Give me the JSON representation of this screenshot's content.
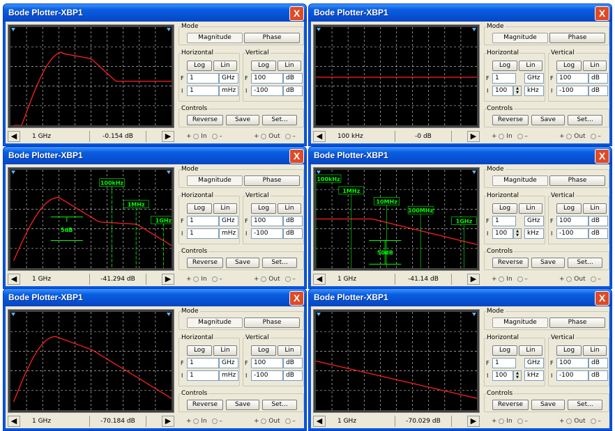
{
  "windows": [
    {
      "title": "Bode Plotter-XBP1",
      "readout_freq": "1 GHz",
      "readout_db": "-0.154 dB",
      "h_f_val": "1",
      "h_f_unit": "GHz",
      "h_i_val": "1",
      "h_i_unit": "mHz",
      "v_f_val": "100",
      "v_f_unit": "dB",
      "v_i_val": "-100",
      "v_i_unit": "dB",
      "curve": "a",
      "markers": []
    },
    {
      "title": "Bode Plotter-XBP1",
      "readout_freq": "100 kHz",
      "readout_db": "-0 dB",
      "h_f_val": "1",
      "h_f_unit": "GHz",
      "h_i_val": "100",
      "h_i_unit": "kHz",
      "v_f_val": "100",
      "v_f_unit": "dB",
      "v_i_val": "-100",
      "v_i_unit": "dB",
      "curve": "flat",
      "markers": []
    },
    {
      "title": "Bode Plotter-XBP1",
      "readout_freq": "1 GHz",
      "readout_db": "-41.294 dB",
      "h_f_val": "1",
      "h_f_unit": "GHz",
      "h_i_val": "1",
      "h_i_unit": "mHz",
      "v_f_val": "100",
      "v_f_unit": "dB",
      "v_i_val": "-100",
      "v_i_unit": "dB",
      "curve": "b",
      "markers": [
        "100kHz",
        "1MHz",
        "1GHz",
        "5dB"
      ]
    },
    {
      "title": "Bode Plotter-XBP1",
      "readout_freq": "1 GHz",
      "readout_db": "-41.14 dB",
      "h_f_val": "1",
      "h_f_unit": "GHz",
      "h_i_val": "100",
      "h_i_unit": "kHz",
      "v_f_val": "100",
      "v_f_unit": "dB",
      "v_i_val": "-100",
      "v_i_unit": "dB",
      "curve": "c",
      "markers": [
        "100kHz",
        "1MHz",
        "10MHz",
        "100MHz",
        "1GHz",
        "50dB"
      ]
    },
    {
      "title": "Bode Plotter-XBP1",
      "readout_freq": "1 GHz",
      "readout_db": "-70.184 dB",
      "h_f_val": "1",
      "h_f_unit": "GHz",
      "h_i_val": "1",
      "h_i_unit": "mHz",
      "v_f_val": "100",
      "v_f_unit": "dB",
      "v_i_val": "-100",
      "v_i_unit": "dB",
      "curve": "d",
      "markers": []
    },
    {
      "title": "Bode Plotter-XBP1",
      "readout_freq": "1 GHz",
      "readout_db": "-70.029 dB",
      "h_f_val": "1",
      "h_f_unit": "GHz",
      "h_i_val": "100",
      "h_i_unit": "kHz",
      "v_f_val": "100",
      "v_f_unit": "dB",
      "v_i_val": "-100",
      "v_i_unit": "dB",
      "curve": "e",
      "markers": []
    }
  ],
  "labels": {
    "close": "X",
    "mode": "Mode",
    "magnitude": "Magnitude",
    "phase": "Phase",
    "horizontal": "Horizontal",
    "vertical": "Vertical",
    "log": "Log",
    "lin": "Lin",
    "f": "F",
    "i": "I",
    "controls": "Controls",
    "reverse": "Reverse",
    "save": "Save",
    "set": "Set...",
    "in": "In",
    "out": "Out",
    "plus": "+",
    "minus": "–",
    "left_arrow": "◀",
    "right_arrow": "▶"
  },
  "colors": {
    "trace": "#ff2020",
    "grid": "#c0c0c0",
    "marker": "#00ff00",
    "screen": "#000000"
  }
}
